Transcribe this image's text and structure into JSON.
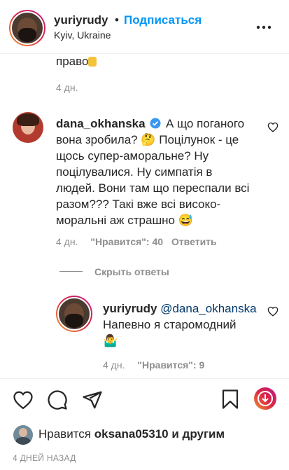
{
  "header": {
    "username": "yuriyrudy",
    "dot": "•",
    "follow_label": "Подписаться",
    "location": "Kyiv, Ukraine",
    "more_icon": "more-icon"
  },
  "prev_comment": {
    "text_tail": "право",
    "time": "4 дн."
  },
  "comment": {
    "username": "dana_okhanska",
    "verified_icon": "verified-badge-icon",
    "lines": [
      "А що поганого",
      "вона зробила? 🤔 Поцілунок - це",
      "щось супер-аморальне? Ну",
      "поцілувалися. Ну симпатія в",
      "людей. Вони там що переспали всі",
      "разом??? Такі вже всі високо-",
      "моральні аж страшно 😅"
    ],
    "time": "4 дн.",
    "likes_label": "\"Нравится\": 40",
    "reply_label": "Ответить"
  },
  "hide_replies_label": "Скрыть ответы",
  "reply": {
    "username": "yuriyrudy",
    "mention": "@dana_okhanska",
    "lines": [
      "Напевно я старомодний",
      "🤷‍♂️"
    ],
    "time": "4 дн.",
    "likes_label": "\"Нравится\": 9"
  },
  "actions": {
    "like_icon": "heart-icon",
    "comment_icon": "comment-icon",
    "share_icon": "share-icon",
    "save_icon": "bookmark-icon",
    "reel_icon": "reels-download-icon"
  },
  "likes": {
    "prefix": "Нравится",
    "user": "oksana05310",
    "suffix": "и другим"
  },
  "posted_time": "4 ДНЕЙ НАЗАД",
  "colors": {
    "accent_blue": "#0095f6",
    "verified_blue": "#3897f0",
    "muted": "#8e8e8e",
    "text": "#262626"
  }
}
